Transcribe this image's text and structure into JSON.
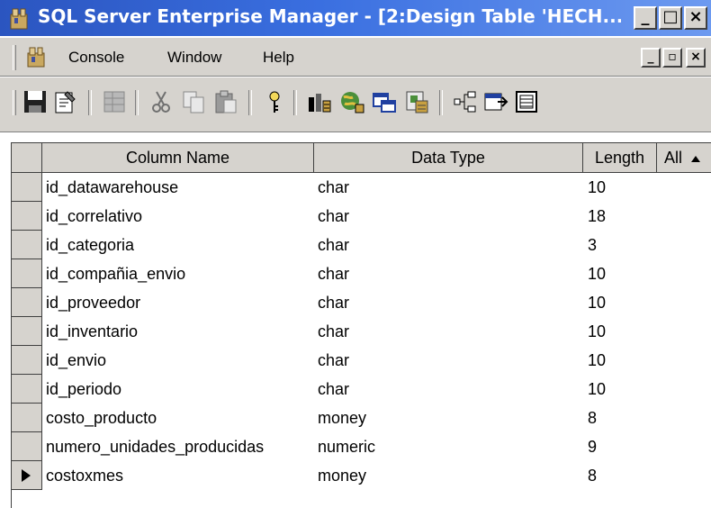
{
  "window": {
    "title": "SQL Server Enterprise Manager - [2:Design Table 'HECH...",
    "min": "_",
    "max": "□",
    "close": "×"
  },
  "menu": {
    "items": [
      "Console",
      "Window",
      "Help"
    ],
    "mdi_min": "_",
    "mdi_restore": "▫",
    "mdi_close": "×"
  },
  "toolbar": {
    "icons": [
      "save-icon",
      "properties-icon",
      "insert-column-icon",
      "cut-icon",
      "copy-icon",
      "paste-icon",
      "primary-key-icon",
      "manage-indexes-icon",
      "manage-relationships-icon",
      "manage-constraints-icon",
      "manage-triggers-icon",
      "generate-script-icon",
      "design-view-icon",
      "grid-icon"
    ]
  },
  "grid": {
    "headers": [
      "Column Name",
      "Data Type",
      "Length",
      "All"
    ],
    "rows": [
      {
        "name": "id_datawarehouse",
        "type": "char",
        "length": "10"
      },
      {
        "name": "id_correlativo",
        "type": "char",
        "length": "18"
      },
      {
        "name": "id_categoria",
        "type": "char",
        "length": "3"
      },
      {
        "name": "id_compañia_envio",
        "type": "char",
        "length": "10"
      },
      {
        "name": "id_proveedor",
        "type": "char",
        "length": "10"
      },
      {
        "name": "id_inventario",
        "type": "char",
        "length": "10"
      },
      {
        "name": "id_envio",
        "type": "char",
        "length": "10"
      },
      {
        "name": "id_periodo",
        "type": "char",
        "length": "10"
      },
      {
        "name": "costo_producto",
        "type": "money",
        "length": "8"
      },
      {
        "name": "numero_unidades_producidas",
        "type": "numeric",
        "length": "9"
      },
      {
        "name": "costoxmes",
        "type": "money",
        "length": "8"
      }
    ],
    "current_row": 10
  },
  "colors": {
    "title_bar": "#2b55c0",
    "chrome": "#d6d3ce"
  }
}
